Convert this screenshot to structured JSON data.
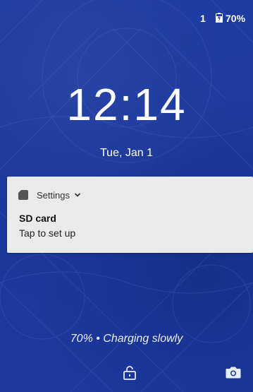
{
  "status_bar": {
    "sim_number": "1",
    "battery_percent": "70%",
    "battery_icon": "battery-charging-icon"
  },
  "lockscreen": {
    "time": "12:14",
    "date": "Tue, Jan 1",
    "charging_status": "70% • Charging slowly"
  },
  "notification": {
    "app_icon": "sd-card-icon",
    "app_name": "Settings",
    "title": "SD card",
    "text": "Tap to set up"
  },
  "bottom_bar": {
    "left_icon": "unlock-icon",
    "right_icon": "camera-icon"
  },
  "colors": {
    "background": "#1c3a9e",
    "notification_bg": "#eaeaea",
    "text_light": "#ffffff"
  }
}
